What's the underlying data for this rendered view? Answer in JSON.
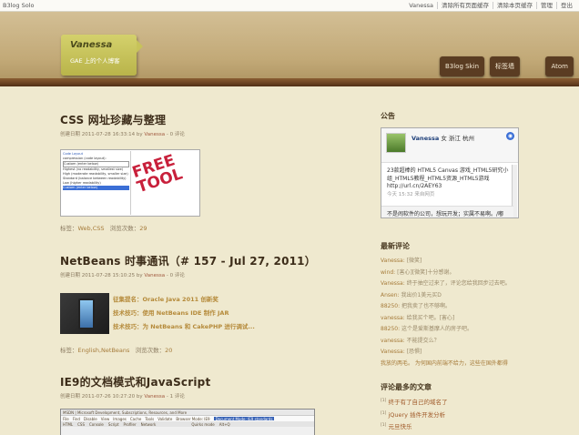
{
  "topbar": {
    "brand": "B3log Solo",
    "links": [
      "Vanessa",
      "清除所有页面缓存",
      "清除本页缓存",
      "管理",
      "登出"
    ]
  },
  "header": {
    "blog_title": "Vanessa",
    "subtitle": "GAE 上的个人博客",
    "nav": [
      "B3log Skin",
      "标签墙",
      "Atom"
    ]
  },
  "posts": [
    {
      "title": "CSS 网址珍藏与整理",
      "meta_prefix": "创建日期 2011-07-28 16:33:14 by ",
      "author": "Vanessa",
      "meta_suffix": " - 0 评论",
      "thumb_lines": [
        "Code Layout",
        "",
        "compression (code layout):",
        "Custom (enter below)",
        "Highest (no readability, smallest size)",
        "High (moderate readability, smaller size)",
        "Standard (balance between readability)",
        "Low (higher readability)",
        "Custom (enter below)"
      ],
      "thumb_badge": "FREE TOOL",
      "tags_label": "标签：",
      "tags": "Web,CSS",
      "views_label": "浏览次数：",
      "views": "29"
    },
    {
      "title": "NetBeans 时事通讯（# 157 - Jul 27, 2011）",
      "meta_prefix": "创建日期 2011-07-28 15:10:25 by ",
      "author": "Vanessa",
      "meta_suffix": " - 0 评论",
      "lines": [
        "征集提名：Oracle Java 2011 创新奖",
        "技术技巧：使用 NetBeans IDE 制作 JAR",
        "技术技巧：为 NetBeans 和 CakePHP 进行调试..."
      ],
      "tags_label": "标签：",
      "tags": "English,NetBeans",
      "views_label": "浏览次数：",
      "views": "20"
    },
    {
      "title": "IE9的文档模式和JavaScript",
      "meta_prefix": "创建日期 2011-07-26 10:27:20 by ",
      "author": "Vanessa",
      "meta_suffix": " - 1 评论",
      "ss_title": "MSDN | Microsoft Development, Subscriptions, Resources, and More",
      "ss_menu": [
        "File",
        "Find",
        "Disable",
        "View",
        "Images",
        "Cache",
        "Tools",
        "Validate",
        "Browser Mode: IE9",
        "Document Mode: IE9 standards"
      ],
      "ss_tabs": [
        "HTML",
        "CSS",
        "Console",
        "Script",
        "Profiler",
        "Network"
      ],
      "ss_extra": [
        "Quirks mode",
        "Alt+Q"
      ]
    }
  ],
  "sidebar": {
    "notice_title": "公告",
    "notice": {
      "name": "Vanessa",
      "info": "女 浙江 杭州",
      "text": "23款超棒的 HTML5 Canvas 游戏_HTML5研究小组_HTML5教程_HTML5资源_HTML5游戏 http://url.cn/2AEY63",
      "time": "今天 15:32 来自网页",
      "footer": "不是闹软件的公司，想玩开发；实属不易啊。/嘟"
    },
    "comments_title": "最新评论",
    "comments": [
      {
        "name": "Vanessa:",
        "text": "[微笑]"
      },
      {
        "name": "wind:",
        "text": "[害心][微笑]十分感谢。"
      },
      {
        "name": "Vanessa:",
        "text": "终于抽空过来了，评论您给我回步过去吧。"
      },
      {
        "name": "Ansen:",
        "text": "我出价1美元买D"
      },
      {
        "name": "88250:",
        "text": "把我卖了也不够啊。"
      },
      {
        "name": "vanessa:",
        "text": "给我买个吧。[害心]"
      },
      {
        "name": "88250:",
        "text": "这个是爱斯基摩人的房子吧。"
      },
      {
        "name": "vanessa:",
        "text": "不能提交么？"
      },
      {
        "name": "Vanessa:",
        "text": "[恐惧]"
      },
      {
        "name": "",
        "text": "我放的两毛。 为何国内前端不给力，这些在国外都得"
      }
    ],
    "articles_title": "评论最多的文章",
    "articles": [
      {
        "n": "[1]",
        "t": "终于有了自己的域名了"
      },
      {
        "n": "[1]",
        "t": "jQuery 插件开发分析"
      },
      {
        "n": "[1]",
        "t": "元旦快乐"
      }
    ]
  },
  "colors": {
    "wood": "#6b4322",
    "sign": "#c7c35a",
    "nav_button": "#5a3c22",
    "link": "#a67b3a"
  }
}
